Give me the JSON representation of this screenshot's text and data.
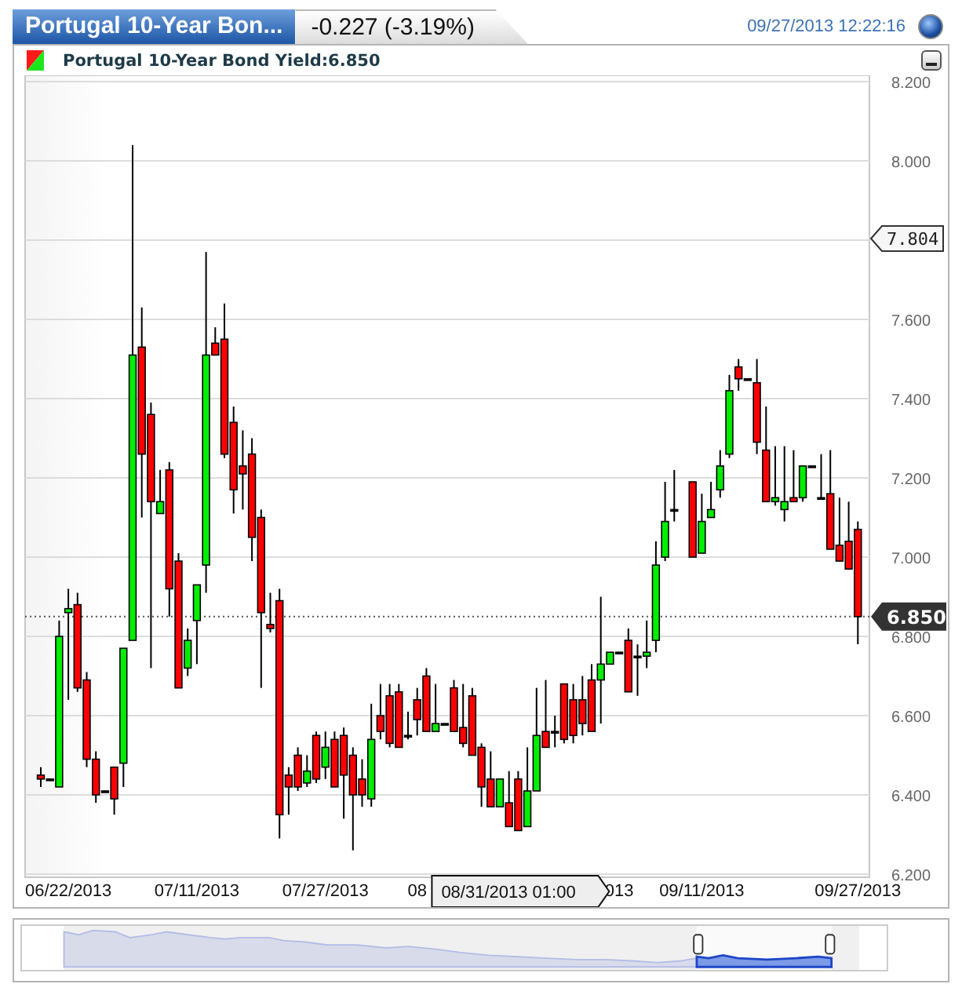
{
  "header": {
    "instrument_tab": "Portugal 10-Year Bon...",
    "change": "-0.227 (-3.19%)",
    "timestamp": "09/27/2013 12:22:16"
  },
  "legend": {
    "label": "Portugal 10-Year Bond Yield:6.850"
  },
  "chart": {
    "chart_data": {
      "type": "candlestick",
      "ylim": [
        6.2,
        8.2
      ],
      "grid": true,
      "yticks": [
        {
          "value": 8.2,
          "label": "8.200"
        },
        {
          "value": 8.0,
          "label": "8.000"
        },
        {
          "value": 7.6,
          "label": "7.600"
        },
        {
          "value": 7.4,
          "label": "7.400"
        },
        {
          "value": 7.2,
          "label": "7.200"
        },
        {
          "value": 7.0,
          "label": "7.000"
        },
        {
          "value": 6.8,
          "label": "6.800"
        },
        {
          "value": 6.6,
          "label": "6.600"
        },
        {
          "value": 6.4,
          "label": "6.400"
        },
        {
          "value": 6.2,
          "label": "6.200"
        }
      ],
      "categories": [
        null,
        null,
        null,
        "06/22/2013",
        null,
        null,
        null,
        null,
        null,
        null,
        null,
        null,
        null,
        null,
        null,
        null,
        null,
        "07/11/2013",
        null,
        null,
        null,
        null,
        null,
        null,
        null,
        null,
        null,
        null,
        null,
        null,
        null,
        "07/27/2013",
        null,
        null,
        null,
        null,
        null,
        null,
        null,
        null,
        null,
        "08",
        null,
        null,
        null,
        null,
        null,
        null,
        null,
        null,
        null,
        null,
        null,
        null,
        null,
        null,
        null,
        null,
        null,
        null,
        null,
        null,
        null,
        "013",
        null,
        null,
        null,
        null,
        null,
        null,
        null,
        null,
        "09/11/2013",
        null,
        null,
        null,
        null,
        null,
        null,
        null,
        null,
        null,
        null,
        null,
        null,
        null,
        null,
        null,
        null,
        "09/27/2013"
      ],
      "ohlc": [
        [
          6.45,
          6.47,
          6.42,
          6.44
        ],
        [
          6.44,
          6.44,
          6.44,
          6.44
        ],
        [
          6.42,
          6.84,
          6.42,
          6.8
        ],
        [
          6.86,
          6.92,
          6.64,
          6.87
        ],
        [
          6.88,
          6.91,
          6.66,
          6.67
        ],
        [
          6.69,
          6.71,
          6.47,
          6.49
        ],
        [
          6.49,
          6.51,
          6.38,
          6.4
        ],
        [
          6.41,
          6.41,
          6.41,
          6.41
        ],
        [
          6.47,
          6.47,
          6.35,
          6.39
        ],
        [
          6.48,
          6.77,
          6.42,
          6.77
        ],
        [
          6.79,
          8.04,
          6.79,
          7.51
        ],
        [
          7.53,
          7.63,
          7.1,
          7.26
        ],
        [
          7.36,
          7.39,
          6.72,
          7.14
        ],
        [
          7.11,
          7.22,
          7.11,
          7.14
        ],
        [
          7.22,
          7.24,
          6.85,
          6.92
        ],
        [
          6.99,
          7.01,
          6.67,
          6.67
        ],
        [
          6.72,
          6.82,
          6.7,
          6.79
        ],
        [
          6.84,
          6.93,
          6.73,
          6.93
        ],
        [
          6.98,
          7.77,
          6.91,
          7.51
        ],
        [
          7.54,
          7.58,
          7.51,
          7.51
        ],
        [
          7.55,
          7.64,
          7.25,
          7.26
        ],
        [
          7.34,
          7.38,
          7.11,
          7.17
        ],
        [
          7.23,
          7.32,
          7.12,
          7.21
        ],
        [
          7.26,
          7.3,
          6.99,
          7.05
        ],
        [
          7.1,
          7.12,
          6.67,
          6.86
        ],
        [
          6.83,
          6.91,
          6.81,
          6.82
        ],
        [
          6.89,
          6.92,
          6.29,
          6.35
        ],
        [
          6.45,
          6.47,
          6.35,
          6.42
        ],
        [
          6.5,
          6.52,
          6.41,
          6.42
        ],
        [
          6.43,
          6.5,
          6.42,
          6.46
        ],
        [
          6.55,
          6.56,
          6.43,
          6.44
        ],
        [
          6.47,
          6.56,
          6.44,
          6.52
        ],
        [
          6.54,
          6.56,
          6.42,
          6.42
        ],
        [
          6.55,
          6.57,
          6.34,
          6.45
        ],
        [
          6.5,
          6.52,
          6.26,
          6.4
        ],
        [
          6.44,
          6.49,
          6.37,
          6.4
        ],
        [
          6.39,
          6.63,
          6.37,
          6.54
        ],
        [
          6.6,
          6.68,
          6.54,
          6.56
        ],
        [
          6.65,
          6.68,
          6.52,
          6.53
        ],
        [
          6.66,
          6.68,
          6.52,
          6.52
        ],
        [
          6.55,
          6.61,
          6.54,
          6.55
        ],
        [
          6.64,
          6.67,
          6.55,
          6.59
        ],
        [
          6.7,
          6.72,
          6.56,
          6.56
        ],
        [
          6.56,
          6.68,
          6.56,
          6.58
        ],
        [
          6.58,
          6.58,
          6.58,
          6.58
        ],
        [
          6.67,
          6.69,
          6.56,
          6.56
        ],
        [
          6.57,
          6.68,
          6.52,
          6.53
        ],
        [
          6.65,
          6.67,
          6.5,
          6.5
        ],
        [
          6.52,
          6.53,
          6.37,
          6.42
        ],
        [
          6.44,
          6.51,
          6.37,
          6.37
        ],
        [
          6.37,
          6.44,
          6.37,
          6.44
        ],
        [
          6.38,
          6.46,
          6.32,
          6.32
        ],
        [
          6.44,
          6.46,
          6.31,
          6.31
        ],
        [
          6.32,
          6.52,
          6.32,
          6.41
        ],
        [
          6.41,
          6.67,
          6.41,
          6.55
        ],
        [
          6.56,
          6.69,
          6.52,
          6.52
        ],
        [
          6.56,
          6.6,
          6.52,
          6.56
        ],
        [
          6.68,
          6.68,
          6.53,
          6.54
        ],
        [
          6.64,
          6.68,
          6.53,
          6.55
        ],
        [
          6.64,
          6.7,
          6.55,
          6.58
        ],
        [
          6.69,
          6.73,
          6.56,
          6.56
        ],
        [
          6.69,
          6.9,
          6.58,
          6.73
        ],
        [
          6.73,
          6.76,
          6.73,
          6.76
        ],
        [
          6.76,
          6.76,
          6.76,
          6.76
        ],
        [
          6.79,
          6.82,
          6.66,
          6.66
        ],
        [
          6.75,
          6.78,
          6.65,
          6.75
        ],
        [
          6.75,
          6.84,
          6.72,
          6.76
        ],
        [
          6.79,
          7.04,
          6.76,
          6.98
        ],
        [
          7.0,
          7.19,
          6.99,
          7.09
        ],
        [
          7.12,
          7.22,
          7.09,
          7.12
        ],
        null,
        [
          7.19,
          7.19,
          7.0,
          7.0
        ],
        [
          7.01,
          7.16,
          7.01,
          7.09
        ],
        [
          7.1,
          7.19,
          7.1,
          7.12
        ],
        [
          7.17,
          7.27,
          7.15,
          7.23
        ],
        [
          7.26,
          7.46,
          7.25,
          7.42
        ],
        [
          7.48,
          7.5,
          7.42,
          7.45
        ],
        [
          7.45,
          7.45,
          7.45,
          7.45
        ],
        [
          7.44,
          7.5,
          7.26,
          7.29
        ],
        [
          7.27,
          7.38,
          7.14,
          7.14
        ],
        [
          7.14,
          7.28,
          7.13,
          7.15
        ],
        [
          7.12,
          7.28,
          7.09,
          7.14
        ],
        [
          7.15,
          7.27,
          7.14,
          7.14
        ],
        [
          7.15,
          7.23,
          7.14,
          7.23
        ],
        [
          7.23,
          7.23,
          7.23,
          7.23
        ],
        [
          7.15,
          7.26,
          7.15,
          7.15
        ],
        [
          7.16,
          7.27,
          7.02,
          7.02
        ],
        [
          7.03,
          7.15,
          6.99,
          6.99
        ],
        [
          7.04,
          7.14,
          6.97,
          6.97
        ],
        [
          7.07,
          7.09,
          6.78,
          6.85
        ]
      ],
      "ref_lines": [
        {
          "axis": "y",
          "value": 6.85,
          "label": "6.850"
        }
      ],
      "annotations": [
        "7.804",
        "08/31/2013 01:00"
      ]
    }
  }
}
